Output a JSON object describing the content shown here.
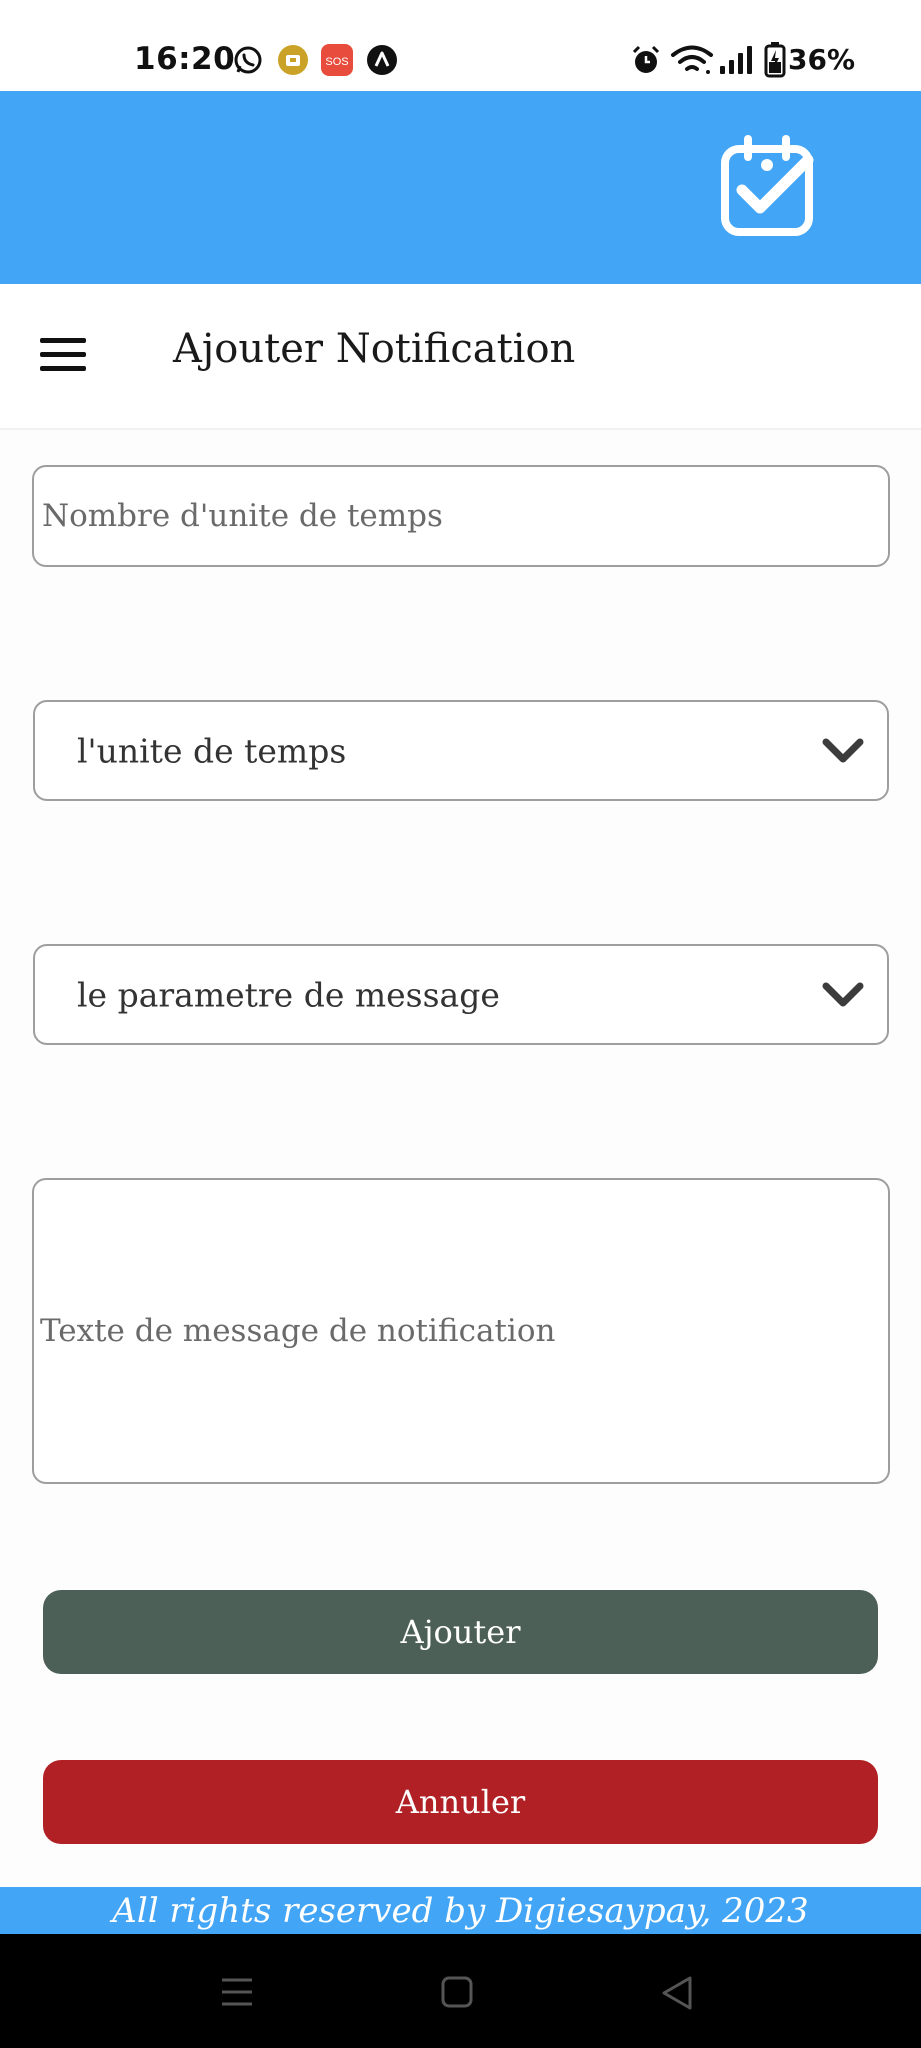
{
  "status_bar": {
    "time": "16:20",
    "left_icons": [
      "whatsapp-icon",
      "app-notification-icon",
      "sos-icon",
      "nav-app-icon"
    ],
    "sos_label": "SOS",
    "right_icons": [
      "alarm-icon",
      "wifi-icon",
      "signal-icon",
      "battery-charging-icon"
    ],
    "battery": "36%"
  },
  "header": {
    "logo_icon": "calendar-check-icon",
    "background_color": "#42a5f5"
  },
  "toolbar": {
    "menu_icon": "hamburger-menu-icon",
    "title": "Ajouter Notification"
  },
  "form": {
    "time_units_count": {
      "placeholder": "Nombre d'unite de temps",
      "value": ""
    },
    "time_unit_select": {
      "selected": "l'unite de temps"
    },
    "message_param_select": {
      "selected": "le parametre de message"
    },
    "message_text": {
      "placeholder": "Texte de message de notification",
      "value": ""
    },
    "submit_label": "Ajouter",
    "cancel_label": "Annuler",
    "submit_color": "#4d6058",
    "cancel_color": "#b02024"
  },
  "footer": {
    "text": "All rights reserved by Digiesaypay, 2023"
  },
  "nav_bar": {
    "buttons": [
      "recents-icon",
      "home-icon",
      "back-icon"
    ]
  }
}
